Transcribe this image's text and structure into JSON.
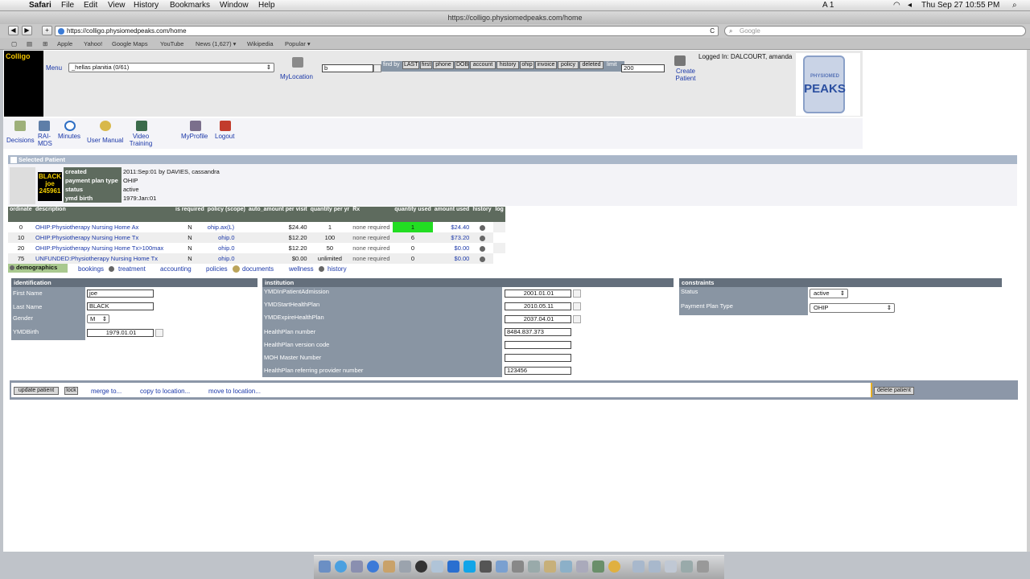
{
  "menubar": {
    "app": "Safari",
    "items": [
      "File",
      "Edit",
      "View",
      "History",
      "Bookmarks",
      "Window",
      "Help"
    ],
    "status": "A 1",
    "clock": "Thu Sep 27  10:55 PM"
  },
  "window": {
    "title": "https://colligo.physiomedpeaks.com/home"
  },
  "browser": {
    "url": "https://colligo.physiomedpeaks.com/home",
    "search_placeholder": "Google",
    "back": "◀",
    "forward": "▶",
    "add": "+",
    "reload": "C"
  },
  "bookmarks": [
    "Apple",
    "Yahoo!",
    "Google Maps",
    "YouTube",
    "News (1,627) ▾",
    "Wikipedia",
    "Popular ▾"
  ],
  "header": {
    "logo": "Colligo",
    "menu": "Menu",
    "select": "_hellas planitia (0/61)",
    "my_location": "MyLocation",
    "find_value": "b",
    "find_by": "find by",
    "buttons": [
      "LAST",
      "first",
      "phone",
      "DOB",
      "account",
      "history",
      "ohip",
      "invoice",
      "policy",
      "deleted"
    ],
    "limit_label": "limit",
    "limit_value": "200",
    "create_patient": "Create Patient",
    "logged_in": "Logged In: DALCOURT, amanda",
    "brand_small": "PHYSIOMED",
    "brand": "PEAKS"
  },
  "nav": [
    {
      "label": "Decisions",
      "icon": "decisions-icon"
    },
    {
      "label": "RAI-MDS",
      "icon": "rai-mds-icon"
    },
    {
      "label": "Minutes",
      "icon": "stopwatch-icon"
    },
    {
      "label": "User Manual",
      "icon": "globe-icon"
    },
    {
      "label": "Video Training",
      "icon": "video-icon"
    },
    {
      "label": "MyProfile",
      "icon": "person-icon"
    },
    {
      "label": "Logout",
      "icon": "logout-icon"
    }
  ],
  "selected": {
    "header": "Selected Patient",
    "badge_last": "BLACK",
    "badge_first": "joe",
    "badge_id": "245961",
    "rows": [
      [
        "created",
        "2011:Sep:01 by DAVIES, cassandra"
      ],
      [
        "payment plan type",
        "OHIP"
      ],
      [
        "status",
        "active"
      ],
      [
        "ymd birth",
        "1979:Jan:01"
      ]
    ]
  },
  "tx": {
    "headers": [
      "ordinate",
      "description",
      "is required",
      "policy (scope)",
      "auto_amount per visit",
      "quantity per yr",
      "Rx",
      "quantity used",
      "amount used",
      "history",
      "log"
    ],
    "rows": [
      [
        "0",
        "OHIP:Physiotherapy Nursing Home Ax",
        "N",
        "ohip.ax(L)",
        "$24.40",
        "1",
        "none required",
        "1",
        "$24.40"
      ],
      [
        "10",
        "OHIP:Physiotherapy Nursing Home Tx",
        "N",
        "ohip.0",
        "$12.20",
        "100",
        "none required",
        "6",
        "$73.20"
      ],
      [
        "20",
        "OHIP:Physiotherapy Nursing Home Tx>100max",
        "N",
        "ohip.0",
        "$12.20",
        "50",
        "none required",
        "0",
        "$0.00"
      ],
      [
        "75",
        "UNFUNDED:Physiotherapy Nursing Home Tx",
        "N",
        "ohip.0",
        "$0.00",
        "unlimited",
        "none required",
        "0",
        "$0.00"
      ]
    ]
  },
  "tabs": [
    "demographics",
    "bookings",
    "treatment",
    "accounting",
    "policies",
    "documents",
    "wellness",
    "history"
  ],
  "ident": {
    "header": "identification",
    "labels": [
      "First Name",
      "Last Name",
      "Gender",
      "YMDBirth"
    ],
    "first": "joe",
    "last": "BLACK",
    "gender": "M",
    "birth": "1979.01.01"
  },
  "inst": {
    "header": "institution",
    "labels": [
      "YMDInPatientAdmission",
      "YMDStartHealthPlan",
      "YMDExpireHealthPlan",
      "HealthPlan number",
      "HealthPlan version code",
      "MOH Master Number",
      "HealthPlan referring provider number"
    ],
    "values": [
      "2001.01.01",
      "2010.05.11",
      "2037.04.01",
      "8484.837.373",
      "",
      "",
      "123456"
    ]
  },
  "cons": {
    "header": "constraints",
    "labels": [
      "Status",
      "Payment Plan Type"
    ],
    "status": "active",
    "plan": "OHIP"
  },
  "actions": {
    "update": "update patient",
    "lock": "lock",
    "merge": "merge to...",
    "copy": "copy to location...",
    "move": "move to location...",
    "delete": "delete patient"
  }
}
